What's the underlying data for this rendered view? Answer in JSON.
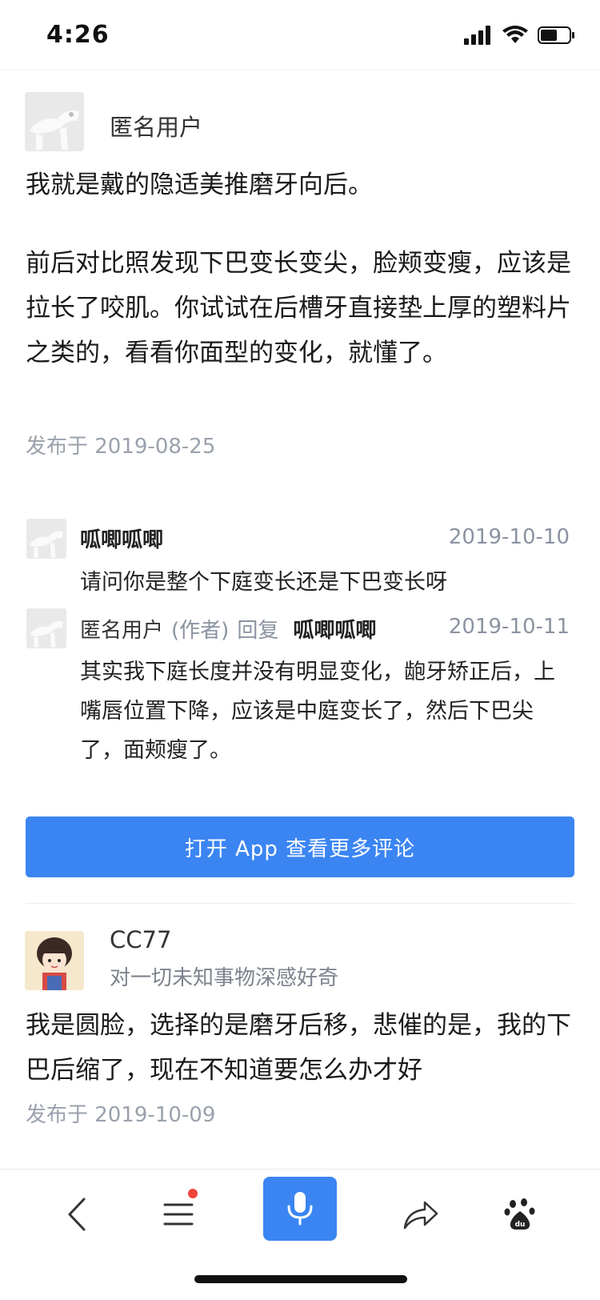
{
  "status_bar": {
    "time": "4:26"
  },
  "answer": {
    "author_name": "匿名用户",
    "paragraph1": "我就是戴的隐适美推磨牙向后。",
    "paragraph2": "前后对比照发现下巴变长变尖，脸颊变瘦，应该是拉长了咬肌。你试试在后槽牙直接垫上厚的塑料片之类的，看看你面型的变化，就懂了。",
    "published": "发布于 2019-08-25"
  },
  "comments": [
    {
      "name": "呱唧呱唧",
      "date": "2019-10-10",
      "text": "请问你是整个下庭变长还是下巴变长呀"
    },
    {
      "name": "匿名用户",
      "author_tag": "(作者)",
      "reply_word": "回复",
      "reply_to": "呱唧呱唧",
      "date": "2019-10-11",
      "text": "其实我下庭长度并没有明显变化，龅牙矫正后，上嘴唇位置下降，应该是中庭变长了，然后下巴尖了，面颊瘦了。"
    }
  ],
  "open_app_button": "打开 App 查看更多评论",
  "answer2": {
    "author_name": "CC77",
    "author_bio": "对一切未知事物深感好奇",
    "paragraph": "我是圆脸，选择的是磨牙后移，悲催的是，我的下巴后缩了，现在不知道要怎么办才好",
    "published": "发布于 2019-10-09"
  },
  "bottom_nav": {
    "items": [
      "back-icon",
      "menu-icon",
      "microphone-icon",
      "share-icon",
      "baidu-paw-icon"
    ]
  },
  "colors": {
    "accent": "#3b85f3",
    "meta_gray": "#9aa1ad",
    "notification_dot": "#f0453a"
  }
}
